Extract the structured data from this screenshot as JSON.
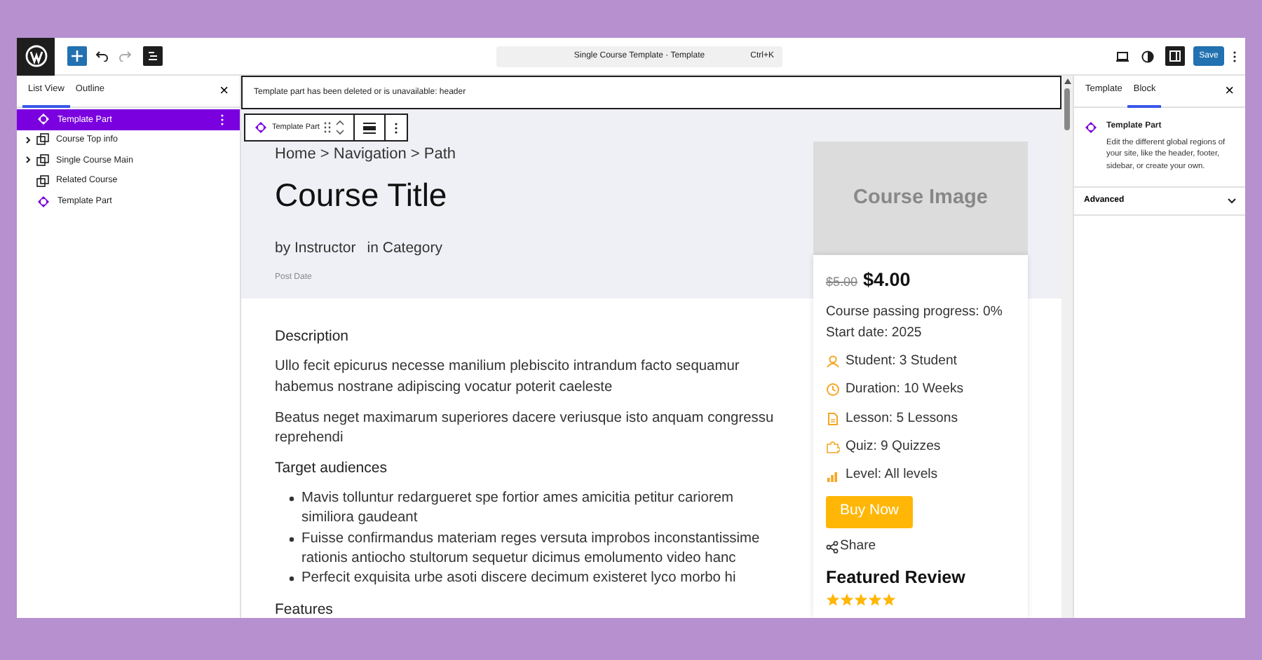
{
  "topbar": {
    "command": "Single Course Template · Template",
    "shortcut": "Ctrl+K",
    "save": "Save"
  },
  "left_panel": {
    "tabs": [
      {
        "label": "List View",
        "selected": true
      },
      {
        "label": "Outline",
        "selected": false
      }
    ],
    "close": "×",
    "items": [
      {
        "label": "Template Part",
        "kind": "template-part",
        "selected": true
      },
      {
        "label": "Course Top info",
        "kind": "group",
        "expanded": false,
        "selected": false
      },
      {
        "label": "Single Course Main",
        "kind": "group",
        "expanded": false,
        "selected": false
      },
      {
        "label": "Related Course",
        "kind": "group",
        "selected": false
      },
      {
        "label": "Template Part",
        "kind": "template-part",
        "selected": false
      }
    ]
  },
  "notice": "Template part has been deleted or is unavailable: header",
  "block_toolbar": {
    "label": "Template Part"
  },
  "hero": {
    "breadcrumb": "Home > Navigation > Path",
    "title": "Course Title",
    "instructor": "by Instructor",
    "category": "in Category",
    "post_date": "Post Date",
    "image_label": "Course Image"
  },
  "card": {
    "old_price": "$5.00",
    "price": "$4.00",
    "progress": "Course passing progress: 0%",
    "start_date": "Start date: 2025",
    "details": [
      {
        "kind": "student",
        "text": "Student: 3 Student"
      },
      {
        "kind": "duration",
        "text": "Duration: 10 Weeks"
      },
      {
        "kind": "lesson",
        "text": "Lesson: 5 Lessons"
      },
      {
        "kind": "quiz",
        "text": "Quiz: 9 Quizzes"
      },
      {
        "kind": "level",
        "text": "Level: All levels"
      }
    ],
    "buy": "Buy Now",
    "share": "Share",
    "review_title": "Featured Review",
    "stars": 5
  },
  "content": [
    {
      "kind": "heading",
      "text": "Description"
    },
    {
      "kind": "paragraph",
      "text": "Ullo fecit epicurus necesse manilium plebiscito intrandum facto sequamur habemus nostrane adipiscing vocatur poterit caeleste"
    },
    {
      "kind": "paragraph",
      "text": "Beatus neget maximarum superiores dacere veriusque isto anquam congressu reprehendi"
    },
    {
      "kind": "heading",
      "text": "Target audiences"
    },
    {
      "kind": "list",
      "items": [
        "Mavis tolluntur redargueret spe fortior ames amicitia petitur cariorem similiora gaudeant",
        "Fuisse confirmandus materiam reges versuta improbos inconstantissime rationis antiocho stultorum sequetur dicimus emolumento video hanc",
        "Perfecit exquisita urbe asoti discere decimum existeret lyco morbo hi"
      ]
    },
    {
      "kind": "heading",
      "text": "Features"
    }
  ],
  "right_panel": {
    "tabs": [
      {
        "label": "Template",
        "selected": false
      },
      {
        "label": "Block",
        "selected": true
      }
    ],
    "close": "×",
    "block_title": "Template Part",
    "block_description": "Edit the different global regions of your site, like the header, footer, sidebar, or create your own.",
    "advanced": "Advanced"
  }
}
